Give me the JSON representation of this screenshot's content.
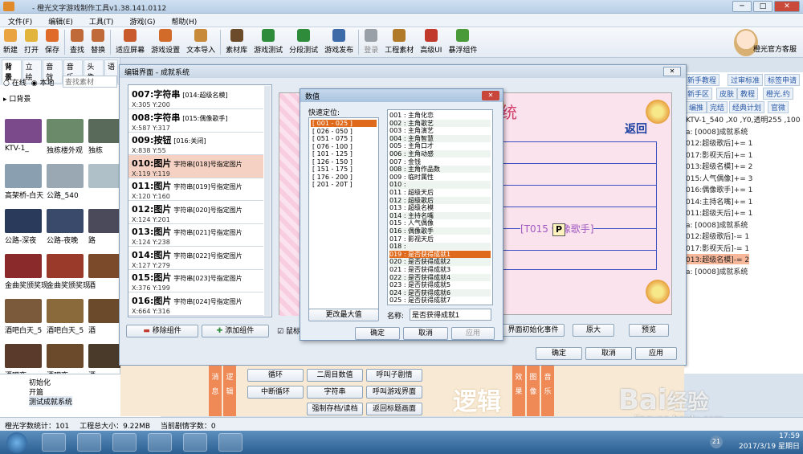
{
  "title": "- 橙光文字游戏制作工具v1.38.141.0112",
  "menu": [
    "文件(F)",
    "编辑(E)",
    "工具(T)",
    "游戏(G)",
    "帮助(H)"
  ],
  "toolbar": [
    {
      "label": "新建",
      "color": "#e9a441"
    },
    {
      "label": "打开",
      "color": "#e2b43b"
    },
    {
      "label": "保存",
      "color": "#e06a2a"
    },
    {
      "label": "查找",
      "color": "#c06a3a"
    },
    {
      "label": "替换",
      "color": "#c06a3a"
    },
    {
      "label": "适应屏幕",
      "color": "#c85a2c"
    },
    {
      "label": "游戏设置",
      "color": "#d26a2a"
    },
    {
      "label": "文本导入",
      "color": "#c88a38"
    },
    {
      "label": "素材库",
      "color": "#6b4b2a"
    },
    {
      "label": "游戏测试",
      "color": "#2e8b3a"
    },
    {
      "label": "分段测试",
      "color": "#2e8b3a"
    },
    {
      "label": "游戏发布",
      "color": "#3c6ba8"
    },
    {
      "label": "登录",
      "color": "#9aa0a8",
      "disabled": true
    },
    {
      "label": "工程素材",
      "color": "#b07a28"
    },
    {
      "label": "高级UI",
      "color": "#c0392b"
    },
    {
      "label": "暴浮组件",
      "color": "#4a9a3a"
    }
  ],
  "service_label": "橙光官方客服",
  "window_buttons": [
    "─",
    "□",
    "✕"
  ],
  "left": {
    "tabs": [
      "背景",
      "立绘",
      "音效",
      "音乐",
      "头像",
      "语"
    ],
    "scope": [
      "在线",
      "本地"
    ],
    "search_placeholder": "查找素材",
    "folder": "口背景",
    "thumbs": [
      {
        "label": "KTV-1_",
        "color": "#7a4a8a"
      },
      {
        "label": "独栋楼外观",
        "color": "#6a8a6a"
      },
      {
        "label": "独栋",
        "color": "#5a6a5a"
      },
      {
        "label": "高架桥-白天",
        "color": "#8aa0b0"
      },
      {
        "label": "公路_540",
        "color": "#9aa8b4"
      },
      {
        "label": "",
        "color": "#b0c0c8"
      },
      {
        "label": "公路-深夜",
        "color": "#2a3a5a"
      },
      {
        "label": "公路-夜晚",
        "color": "#3a4a6a"
      },
      {
        "label": "路",
        "color": "#4a4a5a"
      },
      {
        "label": "金曲奖颁奖现",
        "color": "#8a2a2a"
      },
      {
        "label": "金曲奖颁奖现",
        "color": "#9a3a2a"
      },
      {
        "label": "酒",
        "color": "#7a4a2a"
      },
      {
        "label": "酒吧白天_5",
        "color": "#7a5a3a"
      },
      {
        "label": "酒吧白天_5",
        "color": "#8a6a3a"
      },
      {
        "label": "酒",
        "color": "#6a4a2a"
      },
      {
        "label": "酒吧夜",
        "color": "#5a3a2a"
      },
      {
        "label": "酒吧夜",
        "color": "#6a4a2a"
      },
      {
        "label": "酒",
        "color": "#4a3a2a"
      }
    ],
    "tree": [
      "初始化",
      "开篇",
      "测试成就系统"
    ]
  },
  "right": {
    "tags_row1": [
      "新手教程",
      "过审标准",
      "标签申请"
    ],
    "tags_row2": [
      "新手区",
      "皮肤",
      "教程",
      "橙光.约"
    ],
    "tags_row3": [
      "编推",
      "完结",
      "经典计划",
      "官微"
    ],
    "lines": [
      "KTV-1_540 ,X0 ,Y0,透明255 ,100",
      "a: [0008]成就系统",
      "012:超级歌后]+= 1",
      "017:影视天后]+= 1",
      "013:超级名模]+= 2",
      "015:人气偶像]+= 3",
      "016:偶像歌手]+= 1",
      "014:主持名嘴]+= 1",
      "011:超级天后]+= 1",
      "a: [0008]成就系统",
      "012:超级歌后]-= 1",
      "017:影视天后]-= 1",
      "013:超级名模]-= 2",
      "a: [0008]成就系统"
    ]
  },
  "editor": {
    "title": "编辑界面 - 成就系统",
    "close": "✕",
    "components": [
      {
        "head": "007:字符串",
        "sub": "[014:超级名模]",
        "coords": "X:305  Y:200"
      },
      {
        "head": "008:字符串",
        "sub": "[015:偶像歌手]",
        "coords": "X:587  Y:317"
      },
      {
        "head": "009:按钮",
        "sub": "[016:关闭]",
        "coords": "X:838  Y:55"
      },
      {
        "head": "010:图片",
        "sub": "字符串[018]号指定图片",
        "coords": "X:119  Y:119"
      },
      {
        "head": "011:图片",
        "sub": "字符串[019]号指定图片",
        "coords": "X:120  Y:160"
      },
      {
        "head": "012:图片",
        "sub": "字符串[020]号指定图片",
        "coords": "X:124  Y:201"
      },
      {
        "head": "013:图片",
        "sub": "字符串[021]号指定图片",
        "coords": "X:124  Y:238"
      },
      {
        "head": "014:图片",
        "sub": "字符串[022]号指定图片",
        "coords": "X:127  Y:279"
      },
      {
        "head": "015:图片",
        "sub": "字符串[023]号指定图片",
        "coords": "X:376  Y:199"
      },
      {
        "head": "016:图片",
        "sub": "字符串[024]号指定图片",
        "coords": "X:664  Y:316"
      }
    ],
    "remove_btn": "移除组件",
    "add_btn": "添加组件",
    "mouse_check": "鼠标",
    "init_event_btn": "界面初始化事件",
    "fullsize_btn": "原大",
    "preview_btn": "预览",
    "ok_btn": "确定",
    "cancel_btn": "取消",
    "apply_btn": "应用",
    "scene_title": "统",
    "scene_back": "返回",
    "scene_text": "[T015 偶像歌手]"
  },
  "numdlg": {
    "title": "数值",
    "quick_label": "快速定位:",
    "quick": [
      "[ 001 - 025 ]",
      "[ 026 - 050 ]",
      "[ 051 - 075 ]",
      "[ 076 - 100 ]",
      "[ 101 - 125 ]",
      "[ 126 - 150 ]",
      "[ 151 - 175 ]",
      "[ 176 - 200 ]",
      "[ 201 - 20T ]"
    ],
    "values": [
      "001 : 主角化恋",
      "002 : 主角歌艺",
      "003 : 主角演艺",
      "004 : 主角智慧",
      "005 : 主角口才",
      "006 : 主角动感",
      "007 : 金钱",
      "008 : 主角作品数",
      "009 : 临时属性",
      "010 :",
      "011 : 超级天后",
      "012 : 超级歌后",
      "013 : 超级名模",
      "014 : 主持名嘴",
      "015 : 人气偶像",
      "016 : 偶像歌手",
      "017 : 影视天后",
      "018 :",
      "019 : 是否获得成就1",
      "020 : 是否获得成就2",
      "021 : 是否获得成就3",
      "022 : 是否获得成就4",
      "023 : 是否获得成就5",
      "024 : 是否获得成就6",
      "025 : 是否获得成就7"
    ],
    "selected_index": 18,
    "change_max": "更改最大值",
    "name_label": "名称:",
    "name_value": "是否获得成就1",
    "ok": "确定",
    "cancel": "取消",
    "apply": "应用"
  },
  "logic": {
    "tab1": [
      "消",
      "息"
    ],
    "tab2": [
      "逻",
      "辑"
    ],
    "buttons_r1": [
      "循环",
      "二周目数值",
      "呼叫子剧情"
    ],
    "buttons_r2": [
      "中断循环",
      "字符串",
      "呼叫游戏界面"
    ],
    "buttons_r3": [
      "强制存档/读档",
      "返回标题画面"
    ],
    "watermark": "逻辑",
    "tab3": [
      "效",
      "果"
    ],
    "tab4": [
      "图",
      "像"
    ],
    "tab5": [
      "音",
      "乐"
    ]
  },
  "status": {
    "count": "橙光字数统计：101",
    "size": "工程总大小：9.22MB",
    "current": "当前剧情字数：0"
  },
  "watermark": {
    "brand": "Bai",
    "brand2": "经验",
    "url": "jingyan.baidu.com"
  },
  "taskbar": {
    "time": "17:59",
    "date": "2017/3/19 星期日",
    "badge": "21"
  }
}
